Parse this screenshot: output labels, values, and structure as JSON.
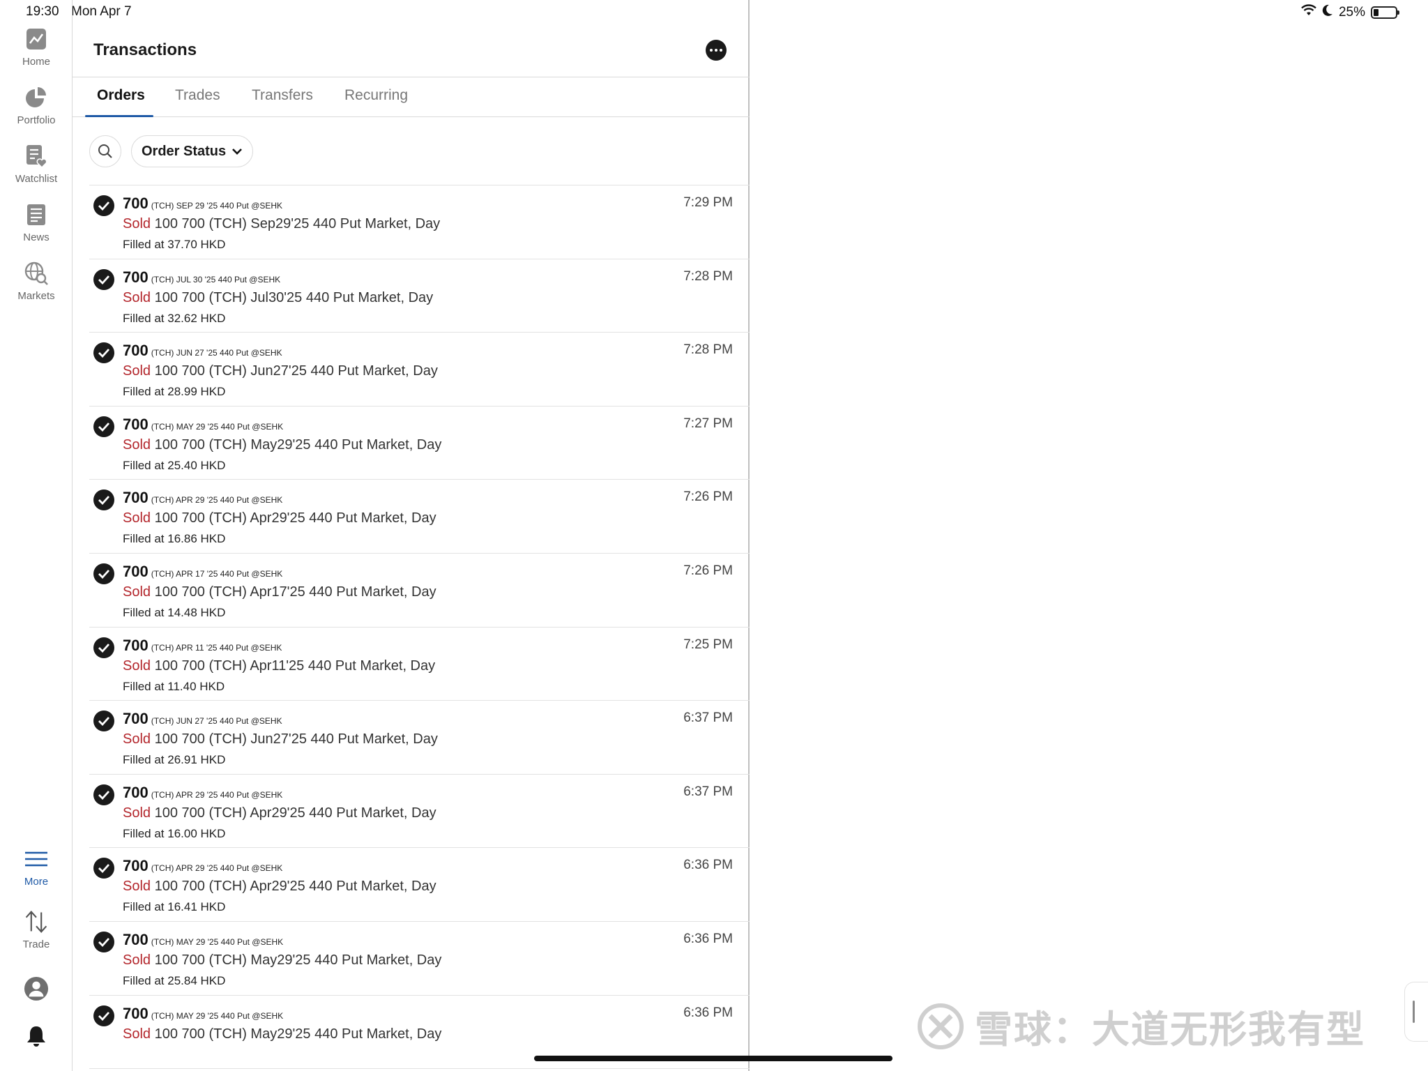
{
  "status_bar": {
    "time": "19:30",
    "date": "Mon Apr 7",
    "battery": "25%"
  },
  "nav": {
    "home": "Home",
    "portfolio": "Portfolio",
    "watchlist": "Watchlist",
    "news": "News",
    "markets": "Markets",
    "more": "More",
    "trade": "Trade"
  },
  "header": {
    "title": "Transactions"
  },
  "tabs": [
    "Orders",
    "Trades",
    "Transfers",
    "Recurring"
  ],
  "filter": {
    "label": "Order Status"
  },
  "orders": [
    {
      "symbol": "700",
      "contract": "(TCH) SEP 29 '25 440 Put @SEHK",
      "side": "Sold",
      "detail": " 100 700 (TCH) Sep29'25 440 Put Market, Day",
      "fill": "Filled at 37.70 HKD",
      "time": "7:29 PM"
    },
    {
      "symbol": "700",
      "contract": "(TCH) JUL 30 '25 440 Put @SEHK",
      "side": "Sold",
      "detail": " 100 700 (TCH) Jul30'25 440 Put Market, Day",
      "fill": "Filled at 32.62 HKD",
      "time": "7:28 PM"
    },
    {
      "symbol": "700",
      "contract": "(TCH) JUN 27 '25 440 Put @SEHK",
      "side": "Sold",
      "detail": " 100 700 (TCH) Jun27'25 440 Put Market, Day",
      "fill": "Filled at 28.99 HKD",
      "time": "7:28 PM"
    },
    {
      "symbol": "700",
      "contract": "(TCH) MAY 29 '25 440 Put @SEHK",
      "side": "Sold",
      "detail": " 100 700 (TCH) May29'25 440 Put Market, Day",
      "fill": "Filled at 25.40 HKD",
      "time": "7:27 PM"
    },
    {
      "symbol": "700",
      "contract": "(TCH) APR 29 '25 440 Put @SEHK",
      "side": "Sold",
      "detail": " 100 700 (TCH) Apr29'25 440 Put Market, Day",
      "fill": "Filled at 16.86 HKD",
      "time": "7:26 PM"
    },
    {
      "symbol": "700",
      "contract": "(TCH) APR 17 '25 440 Put @SEHK",
      "side": "Sold",
      "detail": " 100 700 (TCH) Apr17'25 440 Put Market, Day",
      "fill": "Filled at 14.48 HKD",
      "time": "7:26 PM"
    },
    {
      "symbol": "700",
      "contract": "(TCH) APR 11 '25 440 Put @SEHK",
      "side": "Sold",
      "detail": " 100 700 (TCH) Apr11'25 440 Put Market, Day",
      "fill": "Filled at 11.40 HKD",
      "time": "7:25 PM"
    },
    {
      "symbol": "700",
      "contract": "(TCH) JUN 27 '25 440 Put @SEHK",
      "side": "Sold",
      "detail": " 100 700 (TCH) Jun27'25 440 Put Market, Day",
      "fill": "Filled at 26.91 HKD",
      "time": "6:37 PM"
    },
    {
      "symbol": "700",
      "contract": "(TCH) APR 29 '25 440 Put @SEHK",
      "side": "Sold",
      "detail": " 100 700 (TCH) Apr29'25 440 Put Market, Day",
      "fill": "Filled at 16.00 HKD",
      "time": "6:37 PM"
    },
    {
      "symbol": "700",
      "contract": "(TCH) APR 29 '25 440 Put @SEHK",
      "side": "Sold",
      "detail": " 100 700 (TCH) Apr29'25 440 Put Market, Day",
      "fill": "Filled at 16.41 HKD",
      "time": "6:36 PM"
    },
    {
      "symbol": "700",
      "contract": "(TCH) MAY 29 '25 440 Put @SEHK",
      "side": "Sold",
      "detail": " 100 700 (TCH) May29'25 440 Put Market, Day",
      "fill": "Filled at 25.84 HKD",
      "time": "6:36 PM"
    },
    {
      "symbol": "700",
      "contract": "(TCH) MAY 29 '25 440 Put @SEHK",
      "side": "Sold",
      "detail": " 100 700 (TCH) May29'25 440 Put Market, Day",
      "fill": "",
      "time": "6:36 PM"
    }
  ],
  "watermark": "雪球：大道无形我有型",
  "colors": {
    "accent": "#1f5aa6",
    "sold": "#b3252b",
    "check": "#1a1a1a"
  },
  "icons": {
    "home": "chart-line-icon",
    "portfolio": "pie-chart-icon",
    "watchlist": "list-heart-icon",
    "news": "newspaper-icon",
    "markets": "globe-search-icon",
    "more": "hamburger-menu-icon",
    "trade": "up-down-arrows-icon",
    "account": "user-avatar-icon",
    "notifications": "bell-icon",
    "search": "search-icon",
    "filter": "chevron-down-icon",
    "options": "ellipsis-icon",
    "status": "check-circle-icon"
  }
}
